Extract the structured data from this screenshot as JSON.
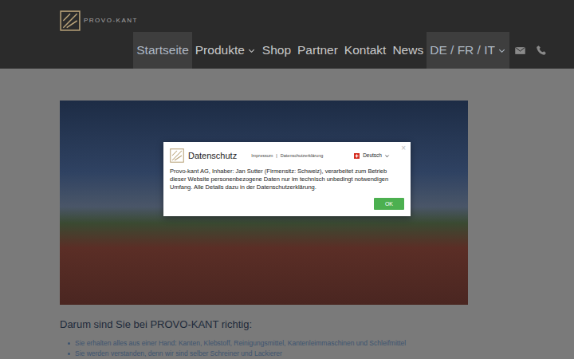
{
  "header": {
    "logo_text": "PROVO-KANT"
  },
  "nav": {
    "items": [
      {
        "label": "Startseite",
        "selected": true,
        "dropdown": false
      },
      {
        "label": "Produkte",
        "selected": false,
        "dropdown": true
      },
      {
        "label": "Shop",
        "selected": false,
        "dropdown": false
      },
      {
        "label": "Partner",
        "selected": false,
        "dropdown": false
      },
      {
        "label": "Kontakt",
        "selected": false,
        "dropdown": false
      },
      {
        "label": "News",
        "selected": false,
        "dropdown": false
      },
      {
        "label": "DE / FR / IT",
        "selected": true,
        "dropdown": true
      }
    ]
  },
  "content": {
    "heading": "Darum sind Sie bei PROVO-KANT richtig:",
    "bullets": [
      "Sie erhalten alles aus einer Hand: Kanten, Klebstoff, Reinigungsmittel, Kantenleimmaschinen und Schleifmittel",
      "Sie werden verstanden, denn wir sind selber Schreiner und Lackierer"
    ]
  },
  "modal": {
    "title": "Datenschutz",
    "links": [
      "Impressum",
      "Datenschutzerklärung"
    ],
    "separator": "|",
    "language": "Deutsch",
    "close": "×",
    "body": "Provo-kant AG, Inhaber: Jan Sutter (Firmensitz: Schweiz), verarbeitet zum Betrieb dieser Website personenbezogene Daten nur im technisch unbedingt notwendigen Umfang. Alle Details dazu in der Datenschutzerklärung.",
    "buttons": [
      "OK"
    ]
  }
}
